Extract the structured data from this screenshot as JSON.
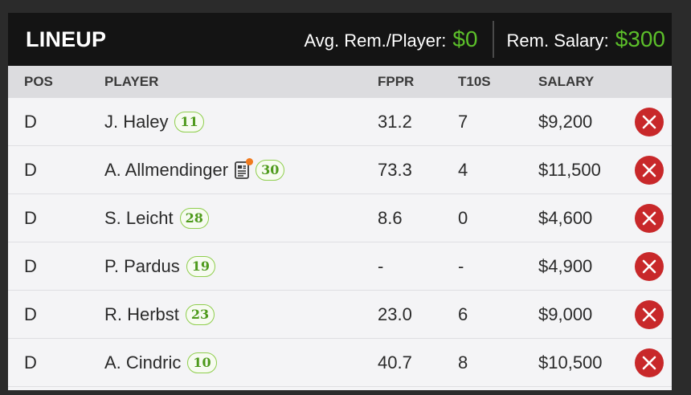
{
  "header": {
    "title": "LINEUP",
    "avg_label": "Avg. Rem./Player:",
    "avg_value": "$0",
    "rem_label": "Rem. Salary:",
    "rem_value": "$300"
  },
  "columns": {
    "pos": "POS",
    "player": "PLAYER",
    "fppr": "FPPR",
    "t10s": "T10S",
    "salary": "SALARY"
  },
  "rows": [
    {
      "pos": "D",
      "player": "J. Haley",
      "badge": "11",
      "fppr": "31.2",
      "t10s": "7",
      "salary": "$9,200",
      "news": false
    },
    {
      "pos": "D",
      "player": "A. Allmendinger",
      "badge": "30",
      "fppr": "73.3",
      "t10s": "4",
      "salary": "$11,500",
      "news": true
    },
    {
      "pos": "D",
      "player": "S. Leicht",
      "badge": "28",
      "fppr": "8.6",
      "t10s": "0",
      "salary": "$4,600",
      "news": false
    },
    {
      "pos": "D",
      "player": "P. Pardus",
      "badge": "19",
      "fppr": "-",
      "t10s": "-",
      "salary": "$4,900",
      "news": false
    },
    {
      "pos": "D",
      "player": "R. Herbst",
      "badge": "23",
      "fppr": "23.0",
      "t10s": "6",
      "salary": "$9,000",
      "news": false
    },
    {
      "pos": "D",
      "player": "A. Cindric",
      "badge": "10",
      "fppr": "40.7",
      "t10s": "8",
      "salary": "$10,500",
      "news": false
    }
  ],
  "icons": {
    "remove": "close-circle-icon",
    "news": "news-document-icon"
  },
  "colors": {
    "accent_green": "#5cbf2a",
    "remove_red": "#c8282a",
    "news_dot": "#f07a1e"
  }
}
